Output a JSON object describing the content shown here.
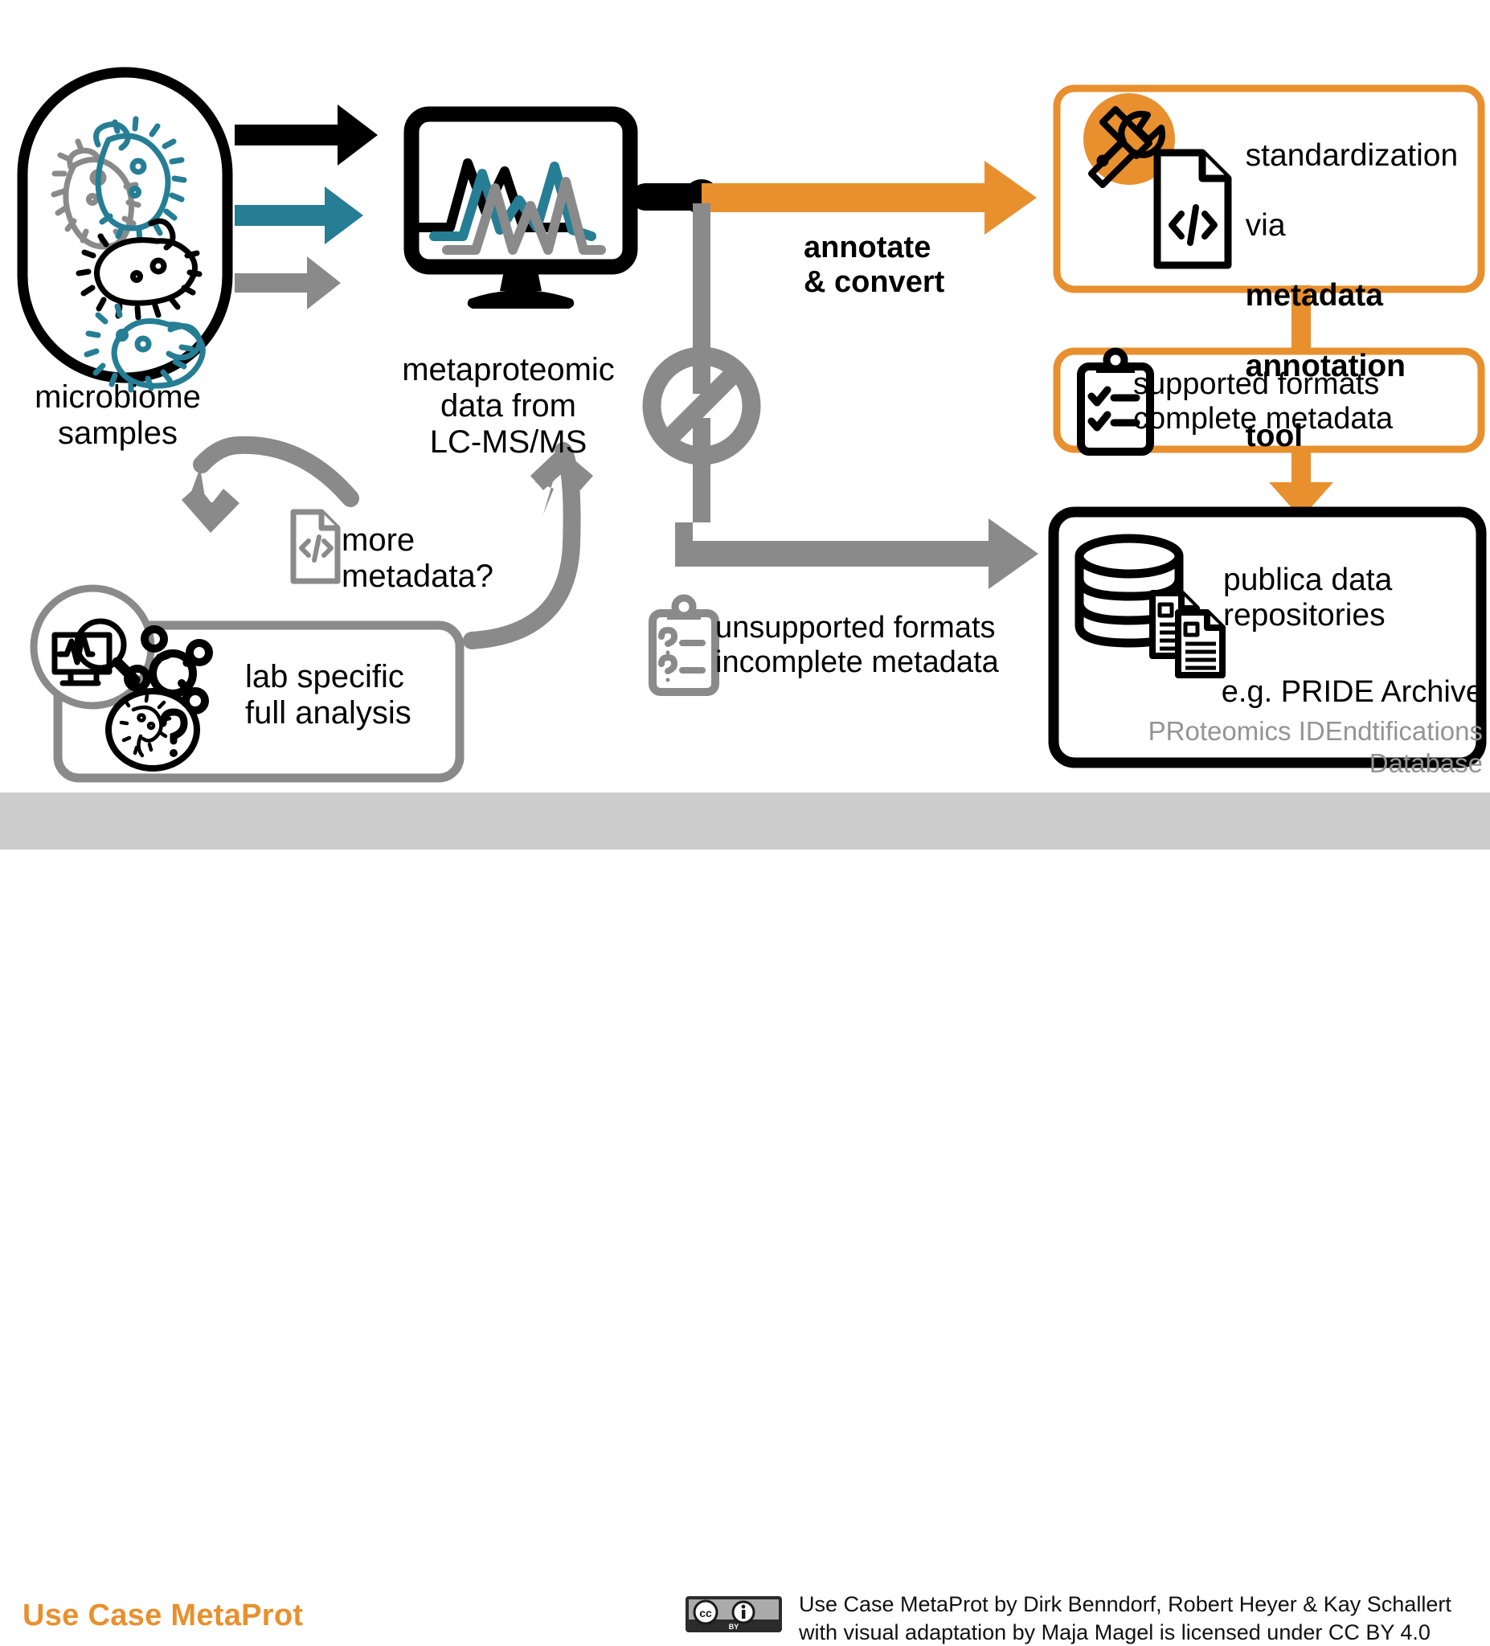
{
  "title": "Use Case MetaProt",
  "colors": {
    "orange": "#e8902e",
    "teal": "#267e95",
    "gray": "#8a8a8a",
    "black": "#000000",
    "light_gray_text": "#949494",
    "footer_bg": "#cccccc"
  },
  "nodes": {
    "microbiome": {
      "label": "microbiome\nsamples"
    },
    "instrument": {
      "label": "metaproteomic\ndata from\nLC-MS/MS"
    },
    "annotate": {
      "label": "annotate\n& convert"
    },
    "standardization": {
      "line1": "standardization",
      "line2": "via",
      "bold1": "metadata",
      "bold2": "annotation",
      "bold3": "tool"
    },
    "supported": {
      "label": "supported formats\ncomplete metadata"
    },
    "unsupported": {
      "label": "unsupported formats\nincomplete metadata"
    },
    "repositories": {
      "label": "publica data\nrepositories",
      "example": "e.g. PRIDE Archive",
      "expansion": "PRoteomics IDEndtifications\nDatabase"
    },
    "more_metadata": {
      "label": "more\nmetadata?"
    },
    "lab_analysis": {
      "label": "lab specific\nfull analysis"
    }
  },
  "footer": {
    "title": "Use Case MetaProt",
    "license_badge": "cc-by-badge",
    "credit": "Use Case MetaProt by Dirk Benndorf, Robert Heyer & Kay Schallert\nwith visual adaptation by Maja Magel is licensed under CC BY 4.0"
  },
  "icons": {
    "sample_container": "capsule-container-icon",
    "bacteria": "bacteria-icon",
    "arrow_black": "arrow-right-black-icon",
    "arrow_teal": "arrow-right-teal-icon",
    "arrow_gray": "arrow-right-gray-icon",
    "monitor": "monitor-chromatogram-icon",
    "orange_arrow": "arrow-right-orange-icon",
    "prohibition": "prohibition-sign-icon",
    "tools": "tools-wrench-screwdriver-icon",
    "code_file": "code-file-icon",
    "clipboard_check": "clipboard-check-icon",
    "clipboard_question": "clipboard-question-icon",
    "database": "database-documents-icon",
    "down_arrow_orange": "arrow-down-orange-icon",
    "loop_arrow_gray": "arrow-loop-gray-icon",
    "magnifier_monitor": "magnifier-monitor-icon",
    "molecule": "molecule-icon",
    "microbe_question": "microbe-question-icon"
  }
}
